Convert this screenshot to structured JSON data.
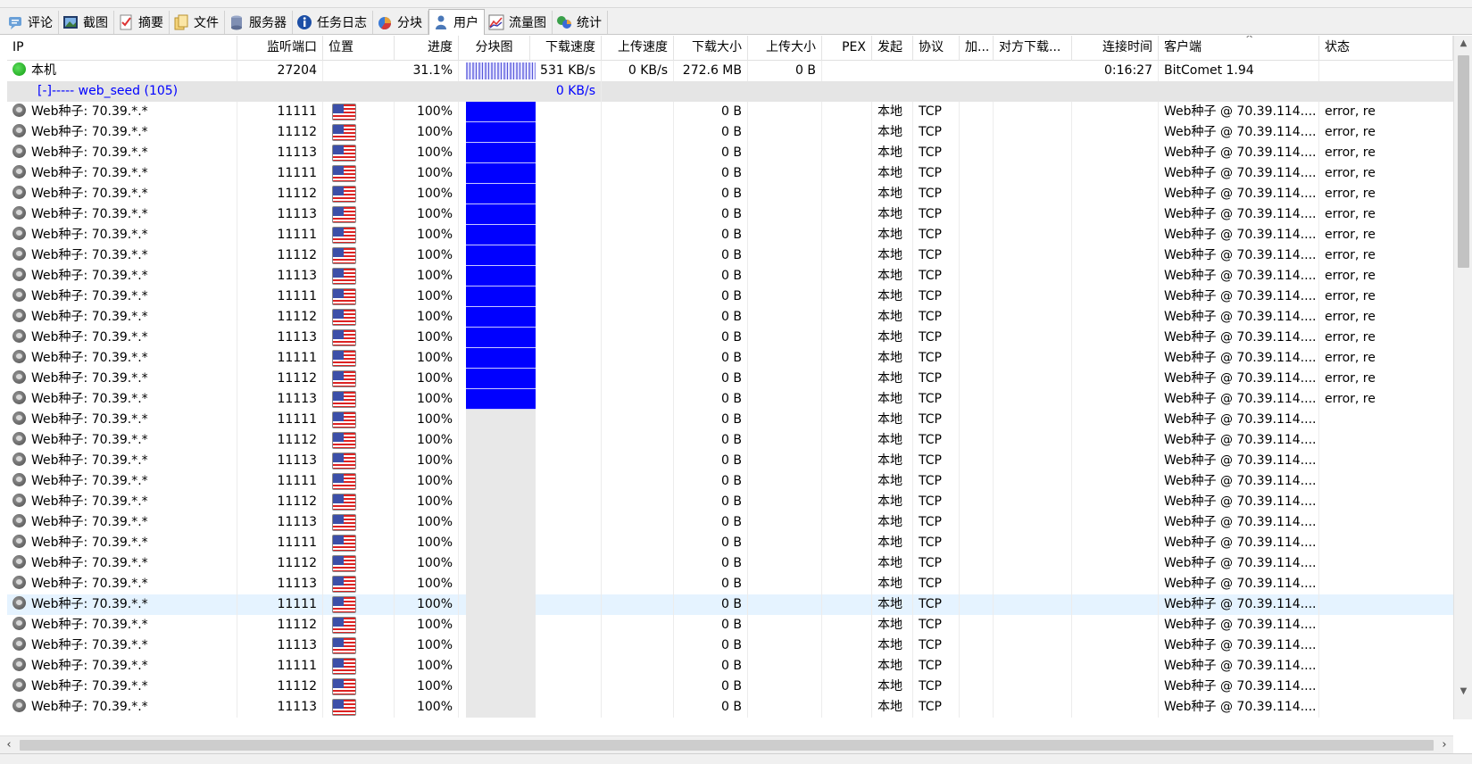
{
  "tabs": [
    {
      "label": "评论",
      "icon": "comment-icon",
      "active": false
    },
    {
      "label": "截图",
      "icon": "screenshot-icon",
      "active": false
    },
    {
      "label": "摘要",
      "icon": "summary-icon",
      "active": false
    },
    {
      "label": "文件",
      "icon": "files-icon",
      "active": false
    },
    {
      "label": "服务器",
      "icon": "server-icon",
      "active": false
    },
    {
      "label": "任务日志",
      "icon": "info-icon",
      "active": false
    },
    {
      "label": "分块",
      "icon": "pie-chart-icon",
      "active": false
    },
    {
      "label": "用户",
      "icon": "user-icon",
      "active": true
    },
    {
      "label": "流量图",
      "icon": "traffic-chart-icon",
      "active": false
    },
    {
      "label": "统计",
      "icon": "statistics-icon",
      "active": false
    }
  ],
  "columns": [
    "IP",
    "监听端口",
    "位置",
    "进度",
    "分块图",
    "下载速度",
    "上传速度",
    "下载大小",
    "上传大小",
    "PEX",
    "发起",
    "协议",
    "加...",
    "对方下载...",
    "连接时间",
    "客户端",
    "状态"
  ],
  "local_row": {
    "ip": "本机",
    "port": "27204",
    "progress": "31.1%",
    "download_speed": "531 KB/s",
    "upload_speed": "0 KB/s",
    "downloaded": "272.6 MB",
    "uploaded": "0 B",
    "connect_time": "0:16:27",
    "client": "BitComet 1.94"
  },
  "group_row": {
    "label": "[-]----- web_seed (105)",
    "download_speed": "0 KB/s"
  },
  "peer_rows": [
    {
      "ip": "Web种子: 70.39.*.*",
      "port": "11111",
      "progress": "100%",
      "pieces": "full",
      "downloaded": "0 B",
      "initiator": "本地",
      "protocol": "TCP",
      "client": "Web种子 @ 70.39.114....",
      "status": "error, re"
    },
    {
      "ip": "Web种子: 70.39.*.*",
      "port": "11112",
      "progress": "100%",
      "pieces": "full",
      "downloaded": "0 B",
      "initiator": "本地",
      "protocol": "TCP",
      "client": "Web种子 @ 70.39.114....",
      "status": "error, re"
    },
    {
      "ip": "Web种子: 70.39.*.*",
      "port": "11113",
      "progress": "100%",
      "pieces": "full",
      "downloaded": "0 B",
      "initiator": "本地",
      "protocol": "TCP",
      "client": "Web种子 @ 70.39.114....",
      "status": "error, re"
    },
    {
      "ip": "Web种子: 70.39.*.*",
      "port": "11111",
      "progress": "100%",
      "pieces": "full",
      "downloaded": "0 B",
      "initiator": "本地",
      "protocol": "TCP",
      "client": "Web种子 @ 70.39.114....",
      "status": "error, re"
    },
    {
      "ip": "Web种子: 70.39.*.*",
      "port": "11112",
      "progress": "100%",
      "pieces": "full",
      "downloaded": "0 B",
      "initiator": "本地",
      "protocol": "TCP",
      "client": "Web种子 @ 70.39.114....",
      "status": "error, re"
    },
    {
      "ip": "Web种子: 70.39.*.*",
      "port": "11113",
      "progress": "100%",
      "pieces": "full",
      "downloaded": "0 B",
      "initiator": "本地",
      "protocol": "TCP",
      "client": "Web种子 @ 70.39.114....",
      "status": "error, re"
    },
    {
      "ip": "Web种子: 70.39.*.*",
      "port": "11111",
      "progress": "100%",
      "pieces": "full",
      "downloaded": "0 B",
      "initiator": "本地",
      "protocol": "TCP",
      "client": "Web种子 @ 70.39.114....",
      "status": "error, re"
    },
    {
      "ip": "Web种子: 70.39.*.*",
      "port": "11112",
      "progress": "100%",
      "pieces": "full",
      "downloaded": "0 B",
      "initiator": "本地",
      "protocol": "TCP",
      "client": "Web种子 @ 70.39.114....",
      "status": "error, re"
    },
    {
      "ip": "Web种子: 70.39.*.*",
      "port": "11113",
      "progress": "100%",
      "pieces": "full",
      "downloaded": "0 B",
      "initiator": "本地",
      "protocol": "TCP",
      "client": "Web种子 @ 70.39.114....",
      "status": "error, re"
    },
    {
      "ip": "Web种子: 70.39.*.*",
      "port": "11111",
      "progress": "100%",
      "pieces": "full",
      "downloaded": "0 B",
      "initiator": "本地",
      "protocol": "TCP",
      "client": "Web种子 @ 70.39.114....",
      "status": "error, re"
    },
    {
      "ip": "Web种子: 70.39.*.*",
      "port": "11112",
      "progress": "100%",
      "pieces": "full",
      "downloaded": "0 B",
      "initiator": "本地",
      "protocol": "TCP",
      "client": "Web种子 @ 70.39.114....",
      "status": "error, re"
    },
    {
      "ip": "Web种子: 70.39.*.*",
      "port": "11113",
      "progress": "100%",
      "pieces": "full",
      "downloaded": "0 B",
      "initiator": "本地",
      "protocol": "TCP",
      "client": "Web种子 @ 70.39.114....",
      "status": "error, re"
    },
    {
      "ip": "Web种子: 70.39.*.*",
      "port": "11111",
      "progress": "100%",
      "pieces": "full",
      "downloaded": "0 B",
      "initiator": "本地",
      "protocol": "TCP",
      "client": "Web种子 @ 70.39.114....",
      "status": "error, re"
    },
    {
      "ip": "Web种子: 70.39.*.*",
      "port": "11112",
      "progress": "100%",
      "pieces": "full",
      "downloaded": "0 B",
      "initiator": "本地",
      "protocol": "TCP",
      "client": "Web种子 @ 70.39.114....",
      "status": "error, re"
    },
    {
      "ip": "Web种子: 70.39.*.*",
      "port": "11113",
      "progress": "100%",
      "pieces": "full",
      "downloaded": "0 B",
      "initiator": "本地",
      "protocol": "TCP",
      "client": "Web种子 @ 70.39.114....",
      "status": "error, re"
    },
    {
      "ip": "Web种子: 70.39.*.*",
      "port": "11111",
      "progress": "100%",
      "pieces": "empty",
      "downloaded": "0 B",
      "initiator": "本地",
      "protocol": "TCP",
      "client": "Web种子 @ 70.39.114....",
      "status": ""
    },
    {
      "ip": "Web种子: 70.39.*.*",
      "port": "11112",
      "progress": "100%",
      "pieces": "empty",
      "downloaded": "0 B",
      "initiator": "本地",
      "protocol": "TCP",
      "client": "Web种子 @ 70.39.114....",
      "status": ""
    },
    {
      "ip": "Web种子: 70.39.*.*",
      "port": "11113",
      "progress": "100%",
      "pieces": "empty",
      "downloaded": "0 B",
      "initiator": "本地",
      "protocol": "TCP",
      "client": "Web种子 @ 70.39.114....",
      "status": ""
    },
    {
      "ip": "Web种子: 70.39.*.*",
      "port": "11111",
      "progress": "100%",
      "pieces": "empty",
      "downloaded": "0 B",
      "initiator": "本地",
      "protocol": "TCP",
      "client": "Web种子 @ 70.39.114....",
      "status": ""
    },
    {
      "ip": "Web种子: 70.39.*.*",
      "port": "11112",
      "progress": "100%",
      "pieces": "empty",
      "downloaded": "0 B",
      "initiator": "本地",
      "protocol": "TCP",
      "client": "Web种子 @ 70.39.114....",
      "status": ""
    },
    {
      "ip": "Web种子: 70.39.*.*",
      "port": "11113",
      "progress": "100%",
      "pieces": "empty",
      "downloaded": "0 B",
      "initiator": "本地",
      "protocol": "TCP",
      "client": "Web种子 @ 70.39.114....",
      "status": ""
    },
    {
      "ip": "Web种子: 70.39.*.*",
      "port": "11111",
      "progress": "100%",
      "pieces": "empty",
      "downloaded": "0 B",
      "initiator": "本地",
      "protocol": "TCP",
      "client": "Web种子 @ 70.39.114....",
      "status": ""
    },
    {
      "ip": "Web种子: 70.39.*.*",
      "port": "11112",
      "progress": "100%",
      "pieces": "empty",
      "downloaded": "0 B",
      "initiator": "本地",
      "protocol": "TCP",
      "client": "Web种子 @ 70.39.114....",
      "status": ""
    },
    {
      "ip": "Web种子: 70.39.*.*",
      "port": "11113",
      "progress": "100%",
      "pieces": "empty",
      "downloaded": "0 B",
      "initiator": "本地",
      "protocol": "TCP",
      "client": "Web种子 @ 70.39.114....",
      "status": ""
    },
    {
      "ip": "Web种子: 70.39.*.*",
      "port": "11111",
      "progress": "100%",
      "pieces": "empty",
      "downloaded": "0 B",
      "initiator": "本地",
      "protocol": "TCP",
      "client": "Web种子 @ 70.39.114....",
      "status": "",
      "selected": true
    },
    {
      "ip": "Web种子: 70.39.*.*",
      "port": "11112",
      "progress": "100%",
      "pieces": "empty",
      "downloaded": "0 B",
      "initiator": "本地",
      "protocol": "TCP",
      "client": "Web种子 @ 70.39.114....",
      "status": ""
    },
    {
      "ip": "Web种子: 70.39.*.*",
      "port": "11113",
      "progress": "100%",
      "pieces": "empty",
      "downloaded": "0 B",
      "initiator": "本地",
      "protocol": "TCP",
      "client": "Web种子 @ 70.39.114....",
      "status": ""
    },
    {
      "ip": "Web种子: 70.39.*.*",
      "port": "11111",
      "progress": "100%",
      "pieces": "empty",
      "downloaded": "0 B",
      "initiator": "本地",
      "protocol": "TCP",
      "client": "Web种子 @ 70.39.114....",
      "status": ""
    },
    {
      "ip": "Web种子: 70.39.*.*",
      "port": "11112",
      "progress": "100%",
      "pieces": "empty",
      "downloaded": "0 B",
      "initiator": "本地",
      "protocol": "TCP",
      "client": "Web种子 @ 70.39.114....",
      "status": ""
    },
    {
      "ip": "Web种子: 70.39.*.*",
      "port": "11113",
      "progress": "100%",
      "pieces": "empty",
      "downloaded": "0 B",
      "initiator": "本地",
      "protocol": "TCP",
      "client": "Web种子 @ 70.39.114....",
      "status": ""
    }
  ],
  "colors": {
    "pieces_full": "#0000ff",
    "group_text": "#0000ff",
    "selected_row": "#e5f3ff",
    "group_row": "#e5e5e5"
  },
  "flag_icon": "us-flag-icon"
}
